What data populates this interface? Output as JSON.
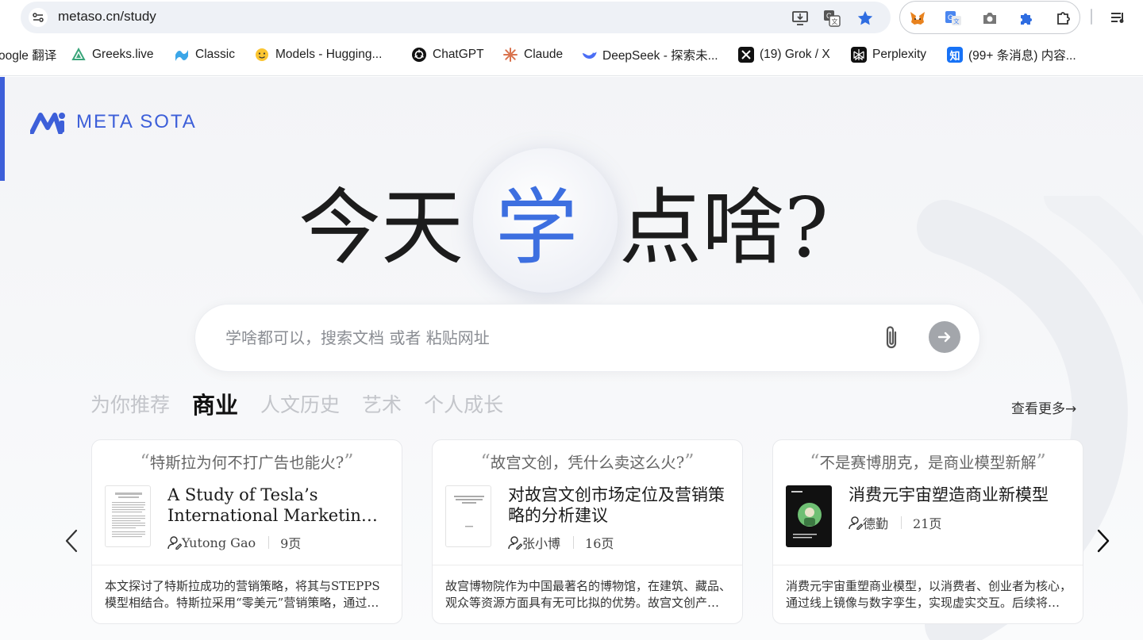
{
  "browser": {
    "url": "metaso.cn/study",
    "omnibox_icons": [
      "install-app-icon",
      "translate-icon",
      "bookmark-star-icon"
    ],
    "extensions": [
      "metamask-icon",
      "google-translate-icon",
      "camera-icon",
      "puzzle-extension-icon",
      "share-icon"
    ],
    "bookmarks": [
      {
        "label": "oogle 翻译",
        "icon": "google-translate-icon"
      },
      {
        "label": "Greeks.live",
        "icon": "greeks-live-icon"
      },
      {
        "label": "Classic",
        "icon": "classic-icon"
      },
      {
        "label": "Models - Hugging...",
        "icon": "hugging-face-icon"
      },
      {
        "label": "ChatGPT",
        "icon": "chatgpt-icon"
      },
      {
        "label": "Claude",
        "icon": "claude-icon"
      },
      {
        "label": "DeepSeek - 探索未...",
        "icon": "deepseek-icon"
      },
      {
        "label": "(19) Grok / X",
        "icon": "x-icon"
      },
      {
        "label": "Perplexity",
        "icon": "perplexity-icon"
      },
      {
        "label": "(99+ 条消息) 内容...",
        "icon": "zhihu-icon"
      }
    ]
  },
  "logo": {
    "text": "META SOTA",
    "color": "#3d5fd9"
  },
  "hero": {
    "before": "今天",
    "accent": "学",
    "after": "点啥?",
    "accent_color": "#3d6fe0"
  },
  "search": {
    "placeholder": "学啥都可以，搜索文档 或者 粘贴网址"
  },
  "tabs": [
    {
      "label": "为你推荐",
      "active": false
    },
    {
      "label": "商业",
      "active": true
    },
    {
      "label": "人文历史",
      "active": false
    },
    {
      "label": "艺术",
      "active": false
    },
    {
      "label": "个人成长",
      "active": false
    }
  ],
  "more_label": "查看更多→",
  "cards": [
    {
      "quote": "特斯拉为何不打广告也能火?",
      "title": "A Study of Tesla’s International Marketing Strategy",
      "author": "Yutong Gao",
      "pages": "9页",
      "description": "本文探讨了特斯拉成功的营销策略，将其与STEPPS模型相结合。特斯拉采用“零美元”营销策略，通过口碑传播获得成功。"
    },
    {
      "quote": "故宫文创，凭什么卖这么火?",
      "title": "对故宫文创市场定位及营销策略的分析建议",
      "author": "张小博",
      "pages": "16页",
      "description": "故宫博物院作为中国最著名的博物馆，在建筑、藏品、观众等资源方面具有无可比拟的优势。故宫文创产品深受欢迎。"
    },
    {
      "quote": "不是赛博朋克，是商业模型新解",
      "title": "消费元宇宙塑造商业新模型",
      "author": "德勤",
      "pages": "21页",
      "description": "消费元宇宙重塑商业模型，以消费者、创业者为核心，通过线上镜像与数字孪生，实现虚实交互。后续将持续演进。"
    }
  ]
}
